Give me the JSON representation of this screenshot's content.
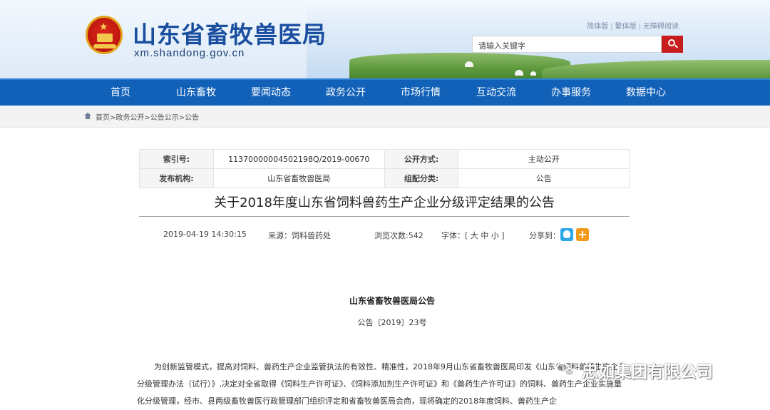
{
  "header": {
    "site_title": "山东省畜牧兽医局",
    "site_domain": "xm.shandong.gov.cn",
    "top_links": [
      "简体版",
      "繁体版",
      "无障碍阅读"
    ],
    "search_placeholder": "请输入关键字"
  },
  "nav": {
    "items": [
      "首页",
      "山东畜牧",
      "要闻动态",
      "政务公开",
      "市场行情",
      "互动交流",
      "办事服务",
      "数据中心"
    ]
  },
  "breadcrumb": "首页>政务公开>公告公示>公告",
  "info": {
    "index_label": "索引号:",
    "index_value": "11370000004502198Q/2019-00670",
    "public_mode_label": "公开方式:",
    "public_mode_value": "主动公开",
    "publisher_label": "发布机构:",
    "publisher_value": "山东省畜牧兽医局",
    "category_label": "组配分类:",
    "category_value": "公告"
  },
  "article": {
    "title": "关于2018年度山东省饲料兽药生产企业分级评定结果的公告",
    "datetime": "2019-04-19 14:30:15",
    "source": "来源：饲料兽药处",
    "views": "浏览次数:542",
    "font_size": "字体：[ 大 中 小 ]",
    "share": "分享到：",
    "doc_heading": "山东省畜牧兽医局公告",
    "doc_number": "公告〔2019〕23号",
    "paragraph": "为创新监管模式，提高对饲料、兽药生产企业监管执法的有效性、精准性，2018年9月山东省畜牧兽医局印发《山东省饲料兽药生产企业分级管理办法（试行）》,决定对全省取得《饲料生产许可证》、《饲料添加剂生产许可证》和《兽药生产许可证》的饲料、兽药生产企业实施量化分级管理，经市、县两级畜牧兽医行政管理部门组织评定和省畜牧兽医局会商，现将确定的2018年度饲料、兽药生产企"
  },
  "watermark": {
    "text": "忠如集团有限公司",
    "icon": "wechat-icon"
  },
  "colors": {
    "nav_bg": "#1261b8",
    "title_blue": "#1a4fa0",
    "search_button": "#c81d1d"
  }
}
